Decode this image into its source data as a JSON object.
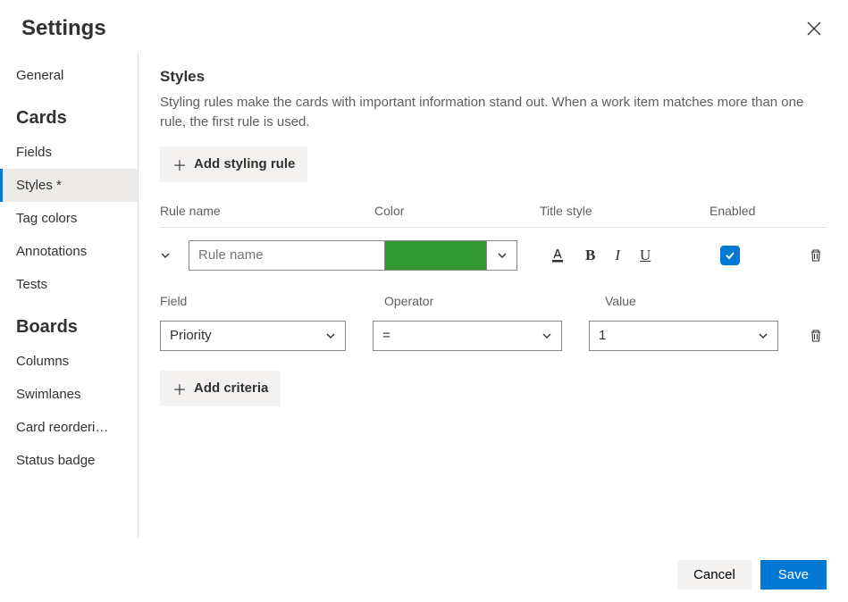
{
  "header": {
    "title": "Settings"
  },
  "sidebar": {
    "general": "General",
    "section_cards": "Cards",
    "fields": "Fields",
    "styles": "Styles *",
    "tag_colors": "Tag colors",
    "annotations": "Annotations",
    "tests": "Tests",
    "section_boards": "Boards",
    "columns": "Columns",
    "swimlanes": "Swimlanes",
    "card_reordering": "Card reorderi…",
    "status_badge": "Status badge"
  },
  "main": {
    "title": "Styles",
    "desc": "Styling rules make the cards with important information stand out. When a work item matches more than one rule, the first rule is used.",
    "add_rule": "Add styling rule",
    "add_criteria": "Add criteria",
    "cols": {
      "rulename": "Rule name",
      "color": "Color",
      "titlestyle": "Title style",
      "enabled": "Enabled"
    },
    "rule": {
      "name_placeholder": "Rule name",
      "color": "#339933",
      "enabled": true
    },
    "criteria_cols": {
      "field": "Field",
      "operator": "Operator",
      "value": "Value"
    },
    "criteria": {
      "field": "Priority",
      "operator": "=",
      "value": "1"
    }
  },
  "footer": {
    "cancel": "Cancel",
    "save": "Save"
  }
}
